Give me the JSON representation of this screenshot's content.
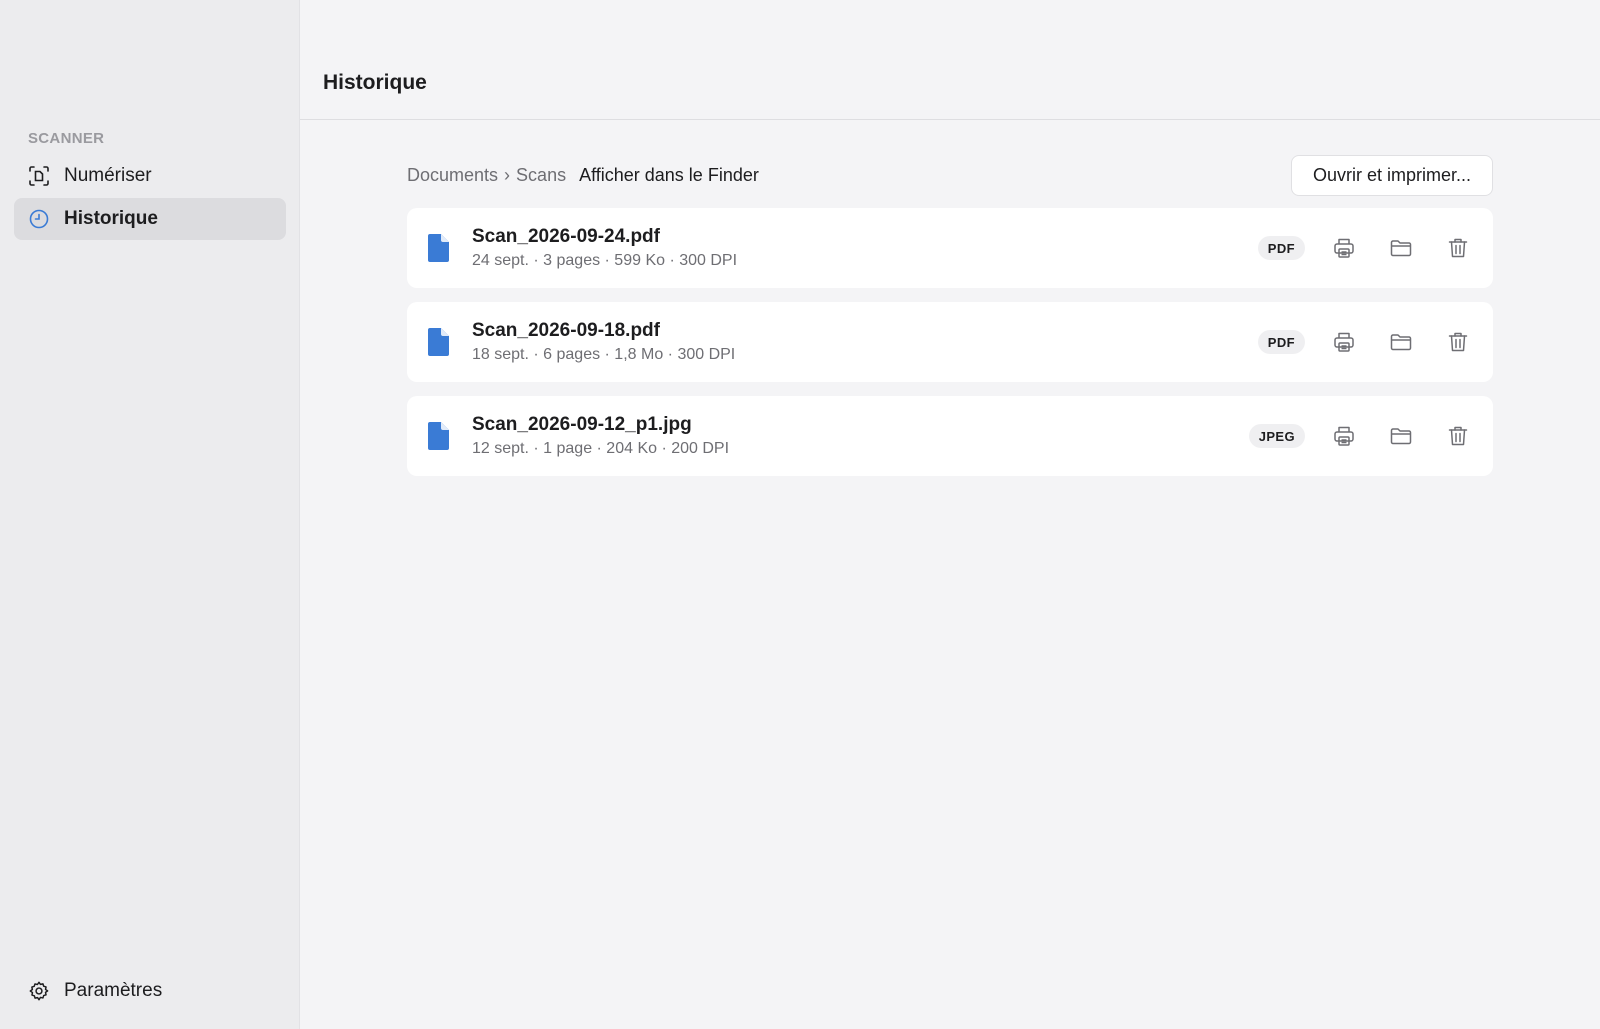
{
  "sidebar": {
    "section_label": "SCANNER",
    "items": [
      {
        "label": "Numériser",
        "icon": "scan-document-icon",
        "active": false
      },
      {
        "label": "Historique",
        "icon": "clock-icon",
        "active": true
      }
    ],
    "footer": {
      "label": "Paramètres",
      "icon": "gear-icon"
    }
  },
  "header": {
    "title": "Historique"
  },
  "toolbar": {
    "breadcrumb": [
      "Documents",
      "Scans"
    ],
    "breadcrumb_separator": "›",
    "finder_link": "Afficher dans le Finder",
    "open_print_label": "Ouvrir et imprimer..."
  },
  "files": [
    {
      "name": "Scan_2026-09-24.pdf",
      "meta": "24 sept. · 3 pages · 599 Ko · 300 DPI",
      "format": "PDF"
    },
    {
      "name": "Scan_2026-09-18.pdf",
      "meta": "18 sept. · 6 pages · 1,8 Mo · 300 DPI",
      "format": "PDF"
    },
    {
      "name": "Scan_2026-09-12_p1.jpg",
      "meta": "12 sept. · 1 page · 204 Ko · 200 DPI",
      "format": "JPEG"
    }
  ],
  "colors": {
    "accent": "#3a7bd5",
    "sidebar_bg": "#ececee",
    "main_bg": "#f4f4f6"
  }
}
